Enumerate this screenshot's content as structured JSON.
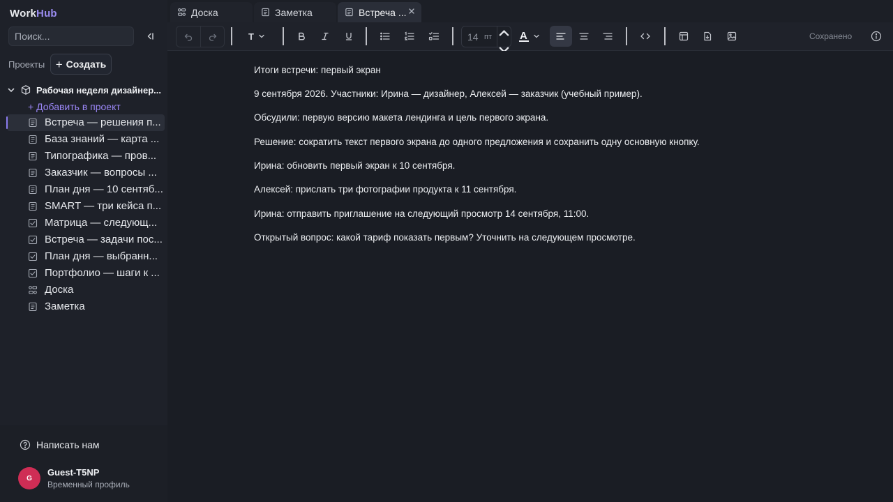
{
  "app": {
    "logo_work": "Work",
    "logo_hub": "Hub"
  },
  "sidebar": {
    "search_placeholder": "Поиск...",
    "projects_label": "Проекты",
    "create_label": "Создать",
    "project_name": "Рабочая неделя дизайнер...",
    "add_to_project": "+ Добавить в проект",
    "items": [
      {
        "label": "Встреча — решения п...",
        "icon": "document-icon"
      },
      {
        "label": "База знаний — карта ...",
        "icon": "document-icon"
      },
      {
        "label": "Типографика — пров...",
        "icon": "document-icon"
      },
      {
        "label": "Заказчик — вопросы ...",
        "icon": "document-icon"
      },
      {
        "label": "План дня — 10 сентяб...",
        "icon": "document-icon"
      },
      {
        "label": "SMART — три кейса п...",
        "icon": "document-icon"
      },
      {
        "label": "Матрица — следующ...",
        "icon": "checkbox-icon"
      },
      {
        "label": "Встреча — задачи пос...",
        "icon": "checkbox-icon"
      },
      {
        "label": "План дня — выбранн...",
        "icon": "checkbox-icon"
      },
      {
        "label": "Портфолио — шаги к ...",
        "icon": "checkbox-icon"
      },
      {
        "label": "Доска",
        "icon": "board-icon"
      },
      {
        "label": "Заметка",
        "icon": "document-icon"
      }
    ],
    "contact_label": "Написать нам",
    "user": {
      "initial": "G",
      "name": "Guest-T5NP",
      "subtitle": "Временный профиль"
    }
  },
  "tabs": [
    {
      "label": "Доска",
      "icon": "board-icon"
    },
    {
      "label": "Заметка",
      "icon": "document-icon"
    },
    {
      "label": "Встреча ...",
      "icon": "document-icon",
      "active": true
    }
  ],
  "toolbar": {
    "text_style": "T",
    "font_size": "14",
    "font_unit": "пт",
    "color_letter": "A",
    "status": "Сохранено"
  },
  "editor": {
    "lines": [
      "Итоги встречи: первый экран",
      "9 сентября 2026. Участники: Ирина — дизайнер, Алексей — заказчик (учебный пример).",
      "Обсудили: первую версию макета лендинга и цель первого экрана.",
      "Решение: сократить текст первого экрана до одного предложения и сохранить одну основную кнопку.",
      "Ирина: обновить первый экран к 10 сентября.",
      "Алексей: прислать три фотографии продукта к 11 сентября.",
      "Ирина: отправить приглашение на следующий просмотр 14 сентября, 11:00.",
      "Открытый вопрос: какой тариф показать первым? Уточнить на следующем просмотре."
    ]
  },
  "colors": {
    "accent": "#8b7cf0",
    "avatar": "#cf2d55",
    "bg": "#1a1d24",
    "sidebar": "#1e2129"
  }
}
